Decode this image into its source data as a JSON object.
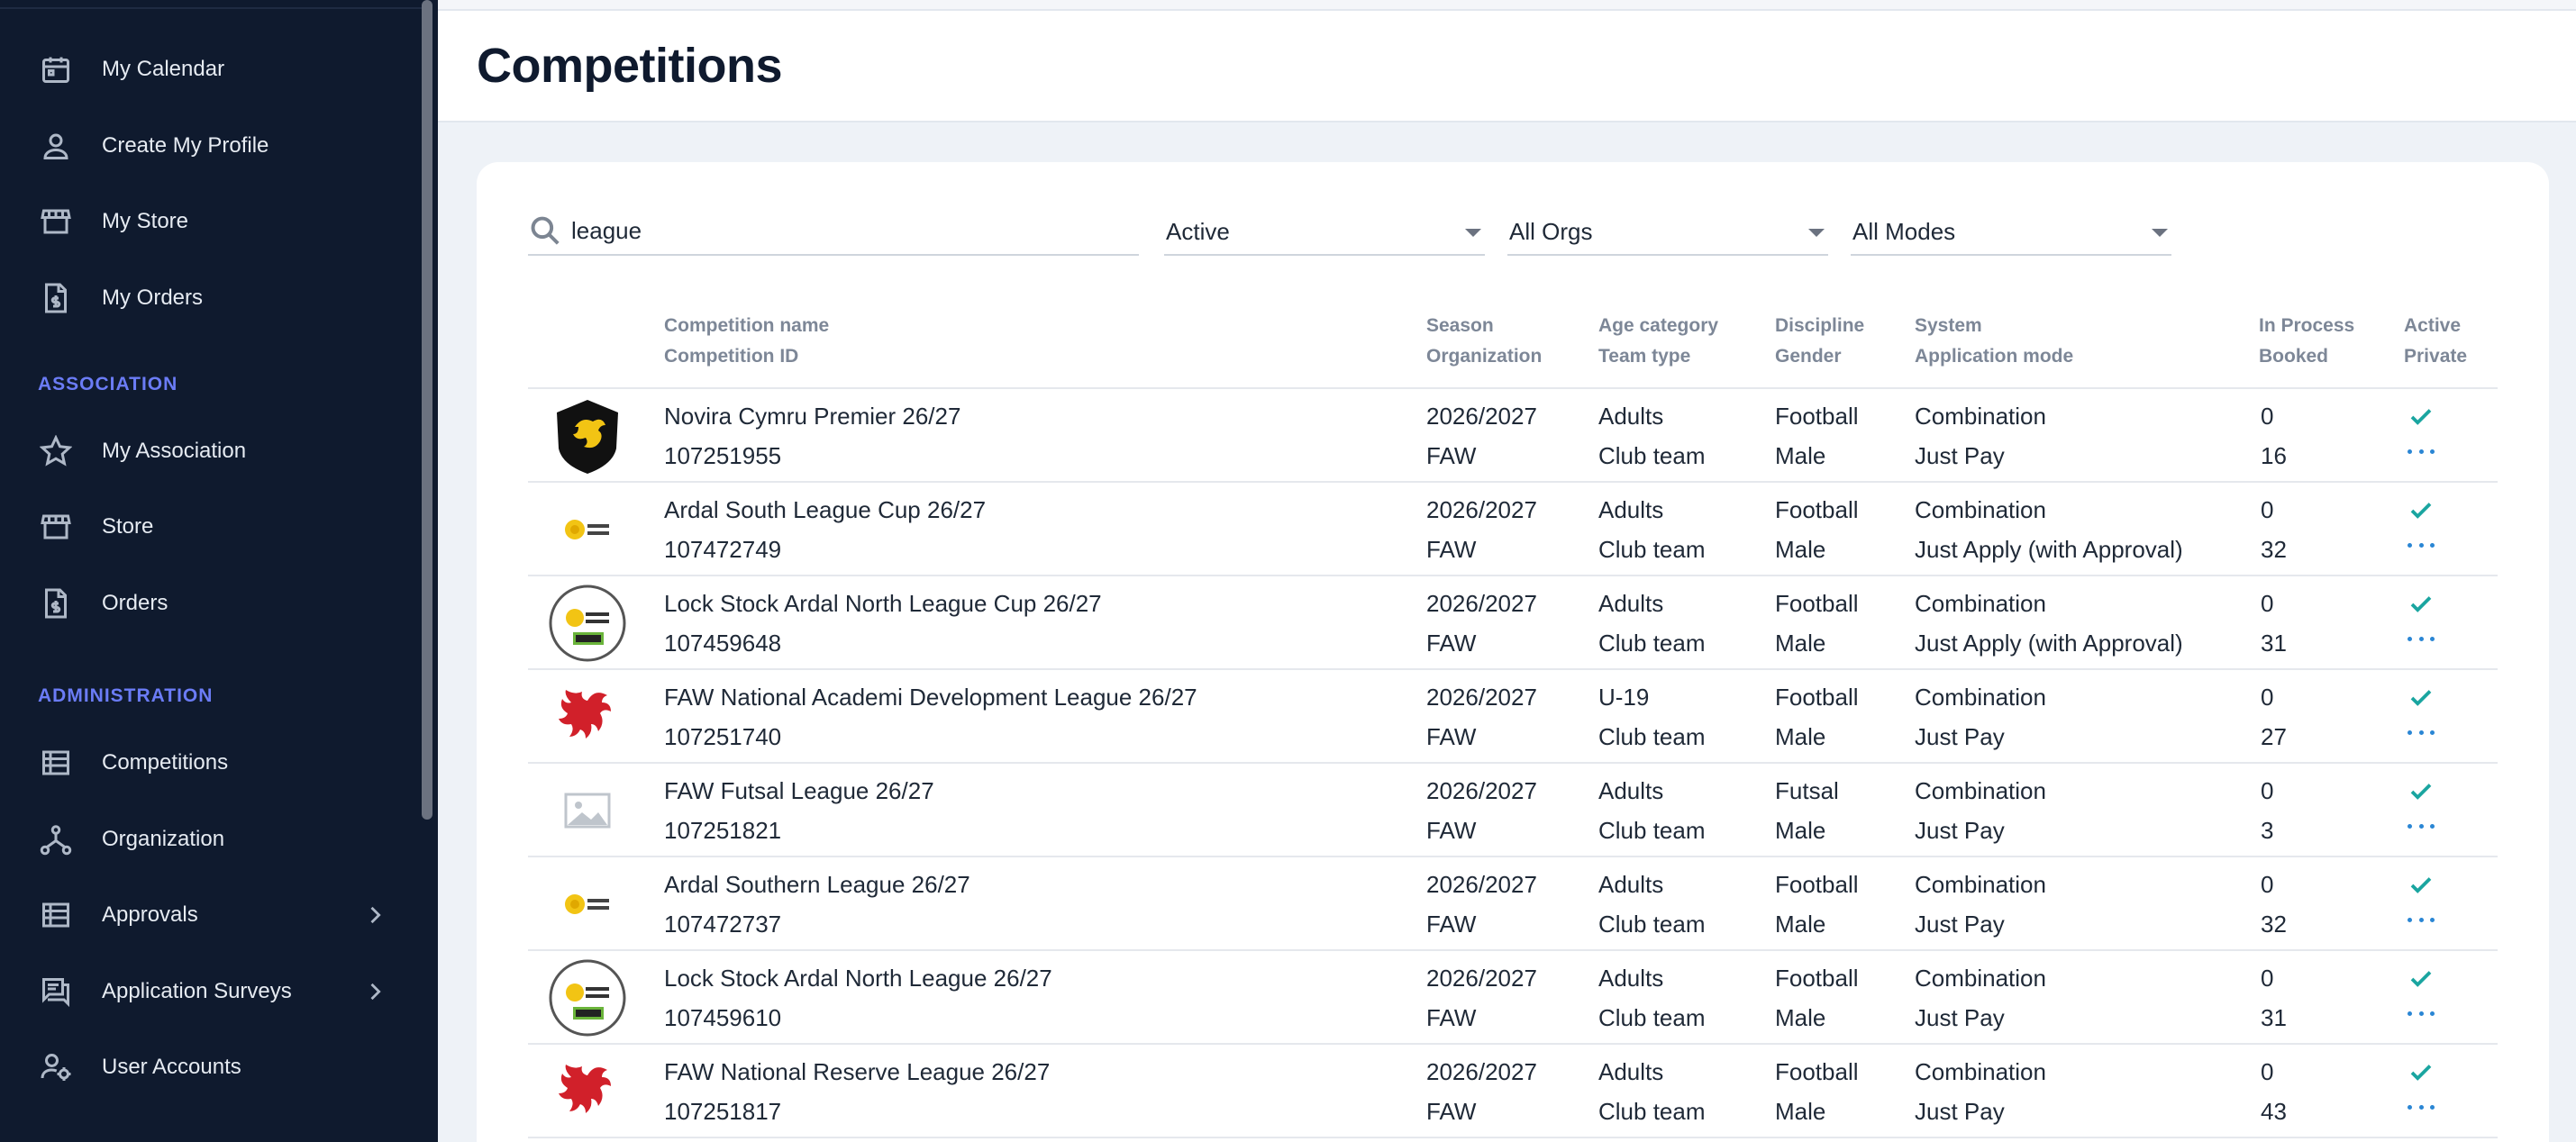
{
  "sidebar": {
    "items": [
      {
        "label": "My Calendar",
        "icon": "calendar-icon"
      },
      {
        "label": "Create My Profile",
        "icon": "person-icon"
      },
      {
        "label": "My Store",
        "icon": "store-icon"
      },
      {
        "label": "My Orders",
        "icon": "invoice-icon"
      }
    ],
    "section_association": "ASSOCIATION",
    "association_items": [
      {
        "label": "My Association",
        "icon": "star-icon"
      },
      {
        "label": "Store",
        "icon": "store-icon"
      },
      {
        "label": "Orders",
        "icon": "invoice-icon"
      }
    ],
    "section_administration": "ADMINISTRATION",
    "admin_items": [
      {
        "label": "Competitions",
        "icon": "list-icon"
      },
      {
        "label": "Organization",
        "icon": "hierarchy-icon"
      },
      {
        "label": "Approvals",
        "icon": "list-icon"
      },
      {
        "label": "Application Surveys",
        "icon": "chat-icon"
      },
      {
        "label": "User Accounts",
        "icon": "user-gear-icon"
      }
    ]
  },
  "header": {
    "title": "Competitions"
  },
  "filters": {
    "search_value": "league",
    "status": "Active",
    "orgs": "All Orgs",
    "modes": "All Modes"
  },
  "columns": {
    "name": "Competition name",
    "id": "Competition ID",
    "season": "Season",
    "organization": "Organization",
    "age": "Age category",
    "team_type": "Team type",
    "discipline": "Discipline",
    "gender": "Gender",
    "system": "System",
    "app_mode": "Application mode",
    "in_process": "In Process",
    "booked": "Booked",
    "active": "Active",
    "private": "Private"
  },
  "colors": {
    "accent_check": "#1aa5a0",
    "accent_link": "#2a86d4",
    "sidebar_bg": "#0f1a2e",
    "section_label": "#6b7cf6"
  },
  "rows": [
    {
      "name": "Novira Cymru Premier 26/27",
      "id": "107251955",
      "season": "2026/2027",
      "org": "FAW",
      "age": "Adults",
      "team": "Club team",
      "discipline": "Football",
      "gender": "Male",
      "system": "Combination",
      "mode": "Just Pay",
      "in_process": "0",
      "booked": "16",
      "logo": "dragon-shield"
    },
    {
      "name": "Ardal South League Cup 26/27",
      "id": "107472749",
      "season": "2026/2027",
      "org": "FAW",
      "age": "Adults",
      "team": "Club team",
      "discipline": "Football",
      "gender": "Male",
      "system": "Combination",
      "mode": "Just Apply (with Approval)",
      "in_process": "0",
      "booked": "32",
      "logo": "ardal"
    },
    {
      "name": "Lock Stock Ardal North League Cup 26/27",
      "id": "107459648",
      "season": "2026/2027",
      "org": "FAW",
      "age": "Adults",
      "team": "Club team",
      "discipline": "Football",
      "gender": "Male",
      "system": "Combination",
      "mode": "Just Apply (with Approval)",
      "in_process": "0",
      "booked": "31",
      "logo": "ardal-north"
    },
    {
      "name": "FAW National Academi Development League 26/27",
      "id": "107251740",
      "season": "2026/2027",
      "org": "FAW",
      "age": "U-19",
      "team": "Club team",
      "discipline": "Football",
      "gender": "Male",
      "system": "Combination",
      "mode": "Just Pay",
      "in_process": "0",
      "booked": "27",
      "logo": "red-dragon"
    },
    {
      "name": "FAW Futsal League 26/27",
      "id": "107251821",
      "season": "2026/2027",
      "org": "FAW",
      "age": "Adults",
      "team": "Club team",
      "discipline": "Futsal",
      "gender": "Male",
      "system": "Combination",
      "mode": "Just Pay",
      "in_process": "0",
      "booked": "3",
      "logo": "placeholder"
    },
    {
      "name": "Ardal Southern League 26/27",
      "id": "107472737",
      "season": "2026/2027",
      "org": "FAW",
      "age": "Adults",
      "team": "Club team",
      "discipline": "Football",
      "gender": "Male",
      "system": "Combination",
      "mode": "Just Pay",
      "in_process": "0",
      "booked": "32",
      "logo": "ardal"
    },
    {
      "name": "Lock Stock Ardal North League 26/27",
      "id": "107459610",
      "season": "2026/2027",
      "org": "FAW",
      "age": "Adults",
      "team": "Club team",
      "discipline": "Football",
      "gender": "Male",
      "system": "Combination",
      "mode": "Just Pay",
      "in_process": "0",
      "booked": "31",
      "logo": "ardal-north"
    },
    {
      "name": "FAW National Reserve League 26/27",
      "id": "107251817",
      "season": "2026/2027",
      "org": "FAW",
      "age": "Adults",
      "team": "Club team",
      "discipline": "Football",
      "gender": "Male",
      "system": "Combination",
      "mode": "Just Pay",
      "in_process": "0",
      "booked": "43",
      "logo": "red-dragon"
    }
  ]
}
